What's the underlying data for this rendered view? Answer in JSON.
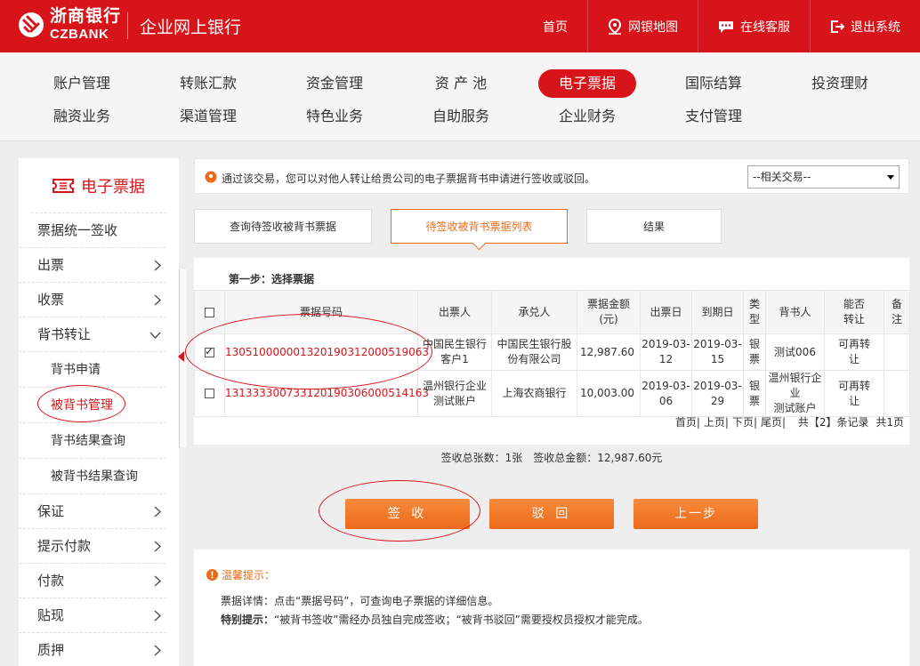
{
  "header": {
    "logo_cn": "浙商银行",
    "logo_en": "CZBANK",
    "site_title": "企业网上银行",
    "nav": [
      {
        "label": "首页",
        "icon": "home"
      },
      {
        "label": "网银地图",
        "icon": "map-pin-icon"
      },
      {
        "label": "在线客服",
        "icon": "chat-icon"
      },
      {
        "label": "退出系统",
        "icon": "logout-icon"
      }
    ]
  },
  "main_menu": {
    "row1": [
      "账户管理",
      "转账汇款",
      "资金管理",
      "资 产 池",
      "电子票据",
      "国际结算",
      "投资理财"
    ],
    "row2": [
      "融资业务",
      "渠道管理",
      "特色业务",
      "自助服务",
      "企业财务",
      "支付管理"
    ],
    "active": "电子票据"
  },
  "sidebar": {
    "title": "电子票据",
    "items": [
      {
        "label": "票据统一签收"
      },
      {
        "label": "出票"
      },
      {
        "label": "收票"
      },
      {
        "label": "背书转让"
      },
      {
        "label": "背书申请"
      },
      {
        "label": "被背书管理"
      },
      {
        "label": "背书结果查询"
      },
      {
        "label": "被背书结果查询"
      },
      {
        "label": "保证"
      },
      {
        "label": "提示付款"
      },
      {
        "label": "付款"
      },
      {
        "label": "贴现"
      },
      {
        "label": "质押"
      }
    ]
  },
  "notice": {
    "text": "通过该交易，您可以对他人转让给贵公司的电子票据背书申请进行签收或驳回。",
    "related_select": "--相关交易--"
  },
  "steps": [
    "查询待签收被背书票据",
    "待签收被背书票据列表",
    "结果"
  ],
  "panel": {
    "step_title": "第一步：选择票据",
    "columns": [
      "票据号码",
      "出票人",
      "承兑人",
      "票据金额\n(元)",
      "出票日",
      "到期日",
      "类\n型",
      "背书人",
      "能否\n转让",
      "备\n注"
    ],
    "col_labels": {
      "num": "票据号码",
      "drawer": "出票人",
      "acceptor": "承兑人",
      "amount1": "票据金额",
      "amount2": "(元)",
      "issue": "出票日",
      "due": "到期日",
      "type1": "类",
      "type2": "型",
      "endorser": "背书人",
      "transfer1": "能否",
      "transfer2": "转让",
      "remark1": "备",
      "remark2": "注"
    },
    "rows": [
      {
        "checked": true,
        "number": "130510000001320190312000519063",
        "drawer1": "中国民生银行",
        "drawer2": "客户1",
        "acceptor1": "中国民生银行股",
        "acceptor2": "份有限公司",
        "amount": "12,987.60",
        "issue1": "2019-03-",
        "issue2": "12",
        "due1": "2019-03-",
        "due2": "15",
        "type1": "银",
        "type2": "票",
        "endorser": "测试006",
        "transfer1": "可再转",
        "transfer2": "让"
      },
      {
        "checked": false,
        "number": "131333300733120190306000514163",
        "drawer1": "温州银行企业",
        "drawer2": "测试账户",
        "acceptor1": "上海农商银行",
        "acceptor2": "",
        "amount": "10,003.00",
        "issue1": "2019-03-",
        "issue2": "06",
        "due1": "2019-03-",
        "due2": "29",
        "type1": "银",
        "type2": "票",
        "endorser1": "温州银行企业",
        "endorser2": "测试账户",
        "transfer1": "可再转",
        "transfer2": "让"
      }
    ],
    "pager": {
      "first": "首页|",
      "prev": "上页|",
      "next": "下页|",
      "last": "尾页|",
      "total": "共【2】条记录",
      "pages": "共1页"
    }
  },
  "summary": "签收总张数：1张　签收总金额：12,987.60元",
  "buttons": {
    "sign": "签 收",
    "reject": "驳 回",
    "back": "上一步"
  },
  "tips": {
    "title": "温馨提示：",
    "line1": "票据详情：点击“票据号码”，可查询电子票据的详细信息。",
    "line2_label": "特别提示：",
    "line2_text": "“被背书签收”需经办员独自完成签收；“被背书驳回”需要授权员授权才能完成。"
  },
  "colors": {
    "brand_red": "#d7141a",
    "accent_orange": "#ec6b1b"
  }
}
